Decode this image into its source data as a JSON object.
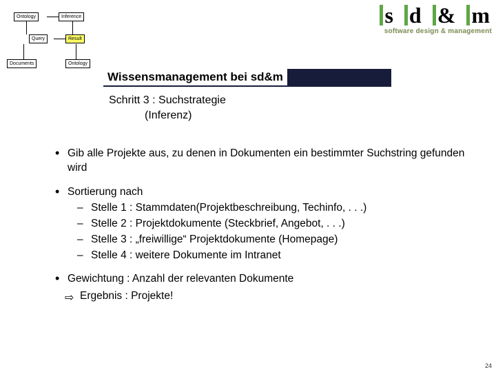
{
  "logo": {
    "brand_letters": "s d & m",
    "tagline": "software design & management"
  },
  "title": "Wissensmanagement bei sd&m",
  "subtitle": {
    "line1": "Schritt 3 : Suchstrategie",
    "line2": "(Inferenz)"
  },
  "diagram": {
    "ontology_top": "Ontology",
    "inference": "Inference",
    "query": "Query",
    "result": "Result",
    "documents": "Documents",
    "ontology_bottom": "Ontology"
  },
  "bullets": {
    "b1": "Gib alle Projekte aus, zu denen in Dokumenten ein bestimmter Suchstring gefunden wird",
    "b2_lead": "Sortierung nach",
    "b2_items": {
      "s1": "Stelle 1 : Stammdaten(Projektbeschreibung, Techinfo, . . .)",
      "s2": "Stelle 2 : Projektdokumente (Steckbrief, Angebot, . . .)",
      "s3": "Stelle 3 : „freiwillige“ Projektdokumente (Homepage)",
      "s4": "Stelle 4 : weitere Dokumente im Intranet"
    },
    "b3": "Gewichtung : Anzahl der relevanten Dokumente",
    "result": "Ergebnis : Projekte!"
  },
  "page_number": "24",
  "colors": {
    "accent_green": "#5fa645",
    "dark_band": "#171c3a",
    "yellow": "#ffff66"
  }
}
